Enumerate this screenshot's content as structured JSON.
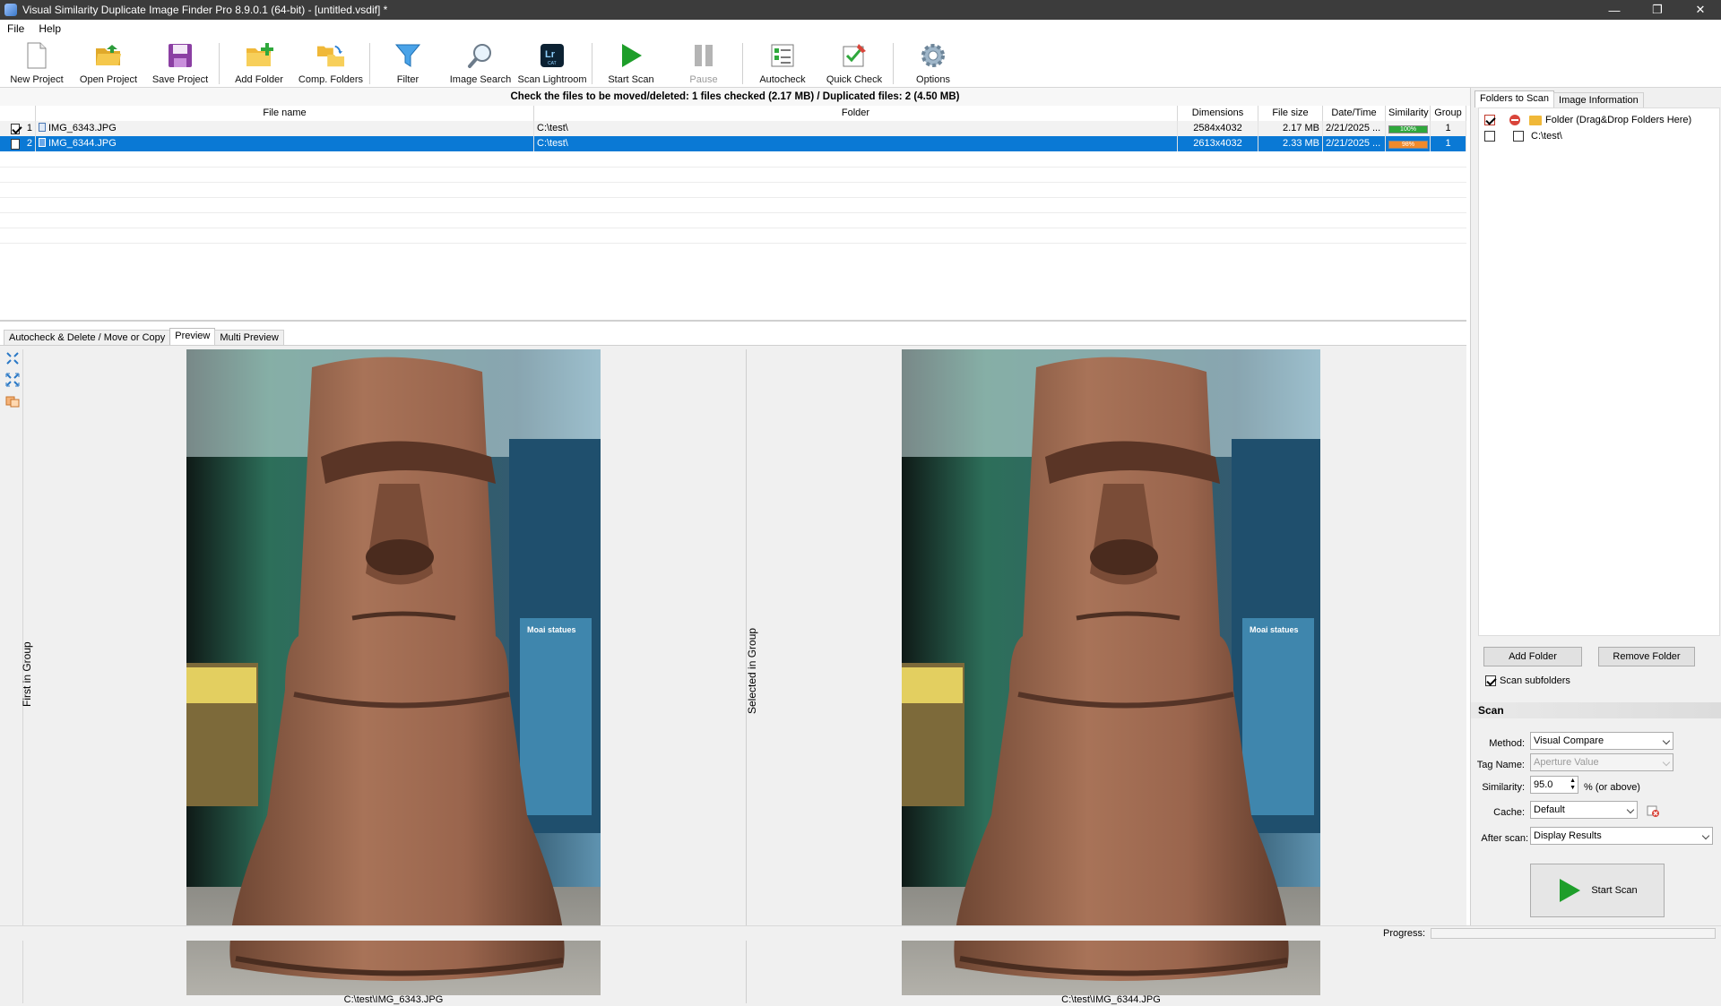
{
  "window": {
    "title": "Visual Similarity Duplicate Image Finder Pro 8.9.0.1 (64-bit) - [untitled.vsdif] *",
    "minimize": "—",
    "restore": "❐",
    "close": "✕"
  },
  "menu": [
    "File",
    "Help"
  ],
  "toolbar": {
    "new_project": "New Project",
    "open_project": "Open Project",
    "save_project": "Save Project",
    "add_folder": "Add Folder",
    "comp_folders": "Comp. Folders",
    "filter": "Filter",
    "image_search": "Image Search",
    "scan_lightroom": "Scan Lightroom",
    "start_scan": "Start Scan",
    "pause": "Pause",
    "autocheck": "Autocheck",
    "quick_check": "Quick Check",
    "options": "Options"
  },
  "status_line": "Check the files to be moved/deleted: 1 files checked (2.17 MB) / Duplicated files: 2 (4.50 MB)",
  "grid": {
    "columns": [
      "File name",
      "Folder",
      "Dimensions",
      "File size",
      "Date/Time",
      "Similarity",
      "Group"
    ],
    "rows": [
      {
        "num": "1",
        "name": "IMG_6343.JPG",
        "folder": "C:\\test\\",
        "dimensions": "2584x4032",
        "size": "2.17 MB",
        "datetime": "2/21/2025 ...",
        "similarity_label": "100%",
        "similarity": 100,
        "group": "1",
        "checked": true
      },
      {
        "num": "2",
        "name": "IMG_6344.JPG",
        "folder": "C:\\test\\",
        "dimensions": "2613x4032",
        "size": "2.33 MB",
        "datetime": "2/21/2025 ...",
        "similarity_label": "98%",
        "similarity": 98,
        "group": "1",
        "checked": false
      }
    ]
  },
  "tabs": [
    "Autocheck & Delete / Move or Copy",
    "Preview",
    "Multi Preview"
  ],
  "preview": {
    "left_label": "First in Group",
    "right_label": "Selected in Group",
    "left_caption": "C:\\test\\IMG_6343.JPG",
    "right_caption": "C:\\test\\IMG_6344.JPG",
    "sign_title": "Moai statues"
  },
  "right_panel": {
    "tabs": [
      "Folders to Scan",
      "Image Information"
    ],
    "folder_header": "Folder (Drag&Drop Folders Here)",
    "folder_path": "C:\\test\\",
    "add_folder": "Add Folder",
    "remove_folder": "Remove Folder",
    "scan_subfolders": "Scan subfolders",
    "scan_section": "Scan",
    "method_label": "Method:",
    "method_value": "Visual Compare",
    "tag_label": "Tag Name:",
    "tag_value": "Aperture Value",
    "similarity_label": "Similarity:",
    "similarity_value": "95.0",
    "similarity_suffix": "% (or above)",
    "cache_label": "Cache:",
    "cache_value": "Default",
    "after_label": "After scan:",
    "after_value": "Display Results",
    "start_scan": "Start Scan"
  },
  "statusbar": {
    "progress_label": "Progress:"
  },
  "colors": {
    "selection": "#0a79d5",
    "sim_100": "#2fa83c",
    "sim_98": "#f08a2b",
    "accent_green": "#1e9e2a"
  }
}
